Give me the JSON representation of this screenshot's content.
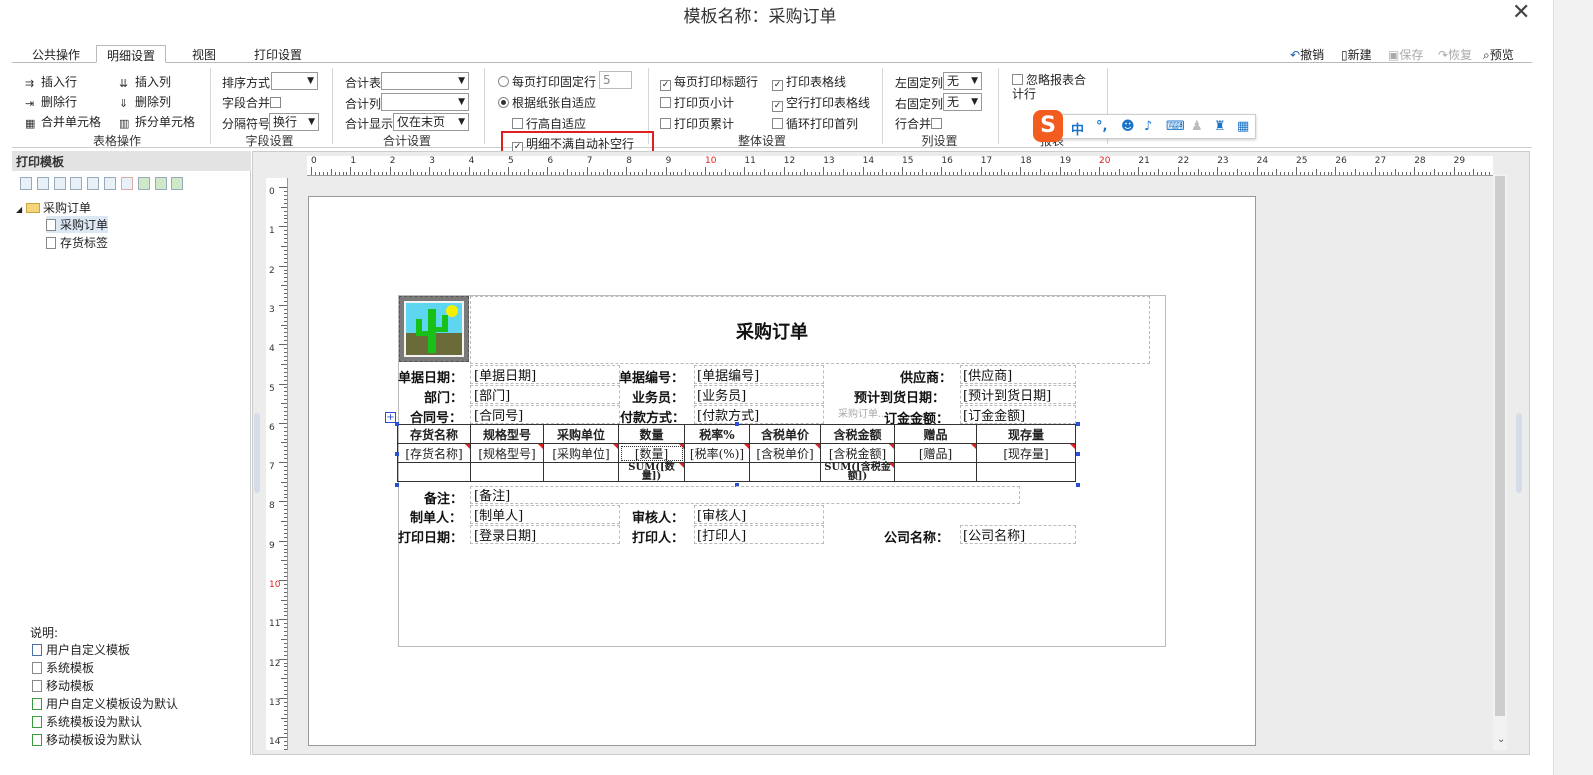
{
  "title": "模板名称：采购订单",
  "tabs": [
    "公共操作",
    "明细设置",
    "视图",
    "打印设置"
  ],
  "toolbar_buttons": {
    "undo": "撤销",
    "new": "新建",
    "save": "保存",
    "redo": "恢复",
    "preview": "预览"
  },
  "table_ops": {
    "insert_row": "插入行",
    "insert_col": "插入列",
    "delete_row": "删除行",
    "delete_col": "删除列",
    "merge": "合并单元格",
    "split": "拆分单元格",
    "group_title": "表格操作"
  },
  "field_settings": {
    "sort": "排序方式",
    "merge": "字段合并",
    "sep": "分隔符号",
    "sep_value": "换行",
    "group_title": "字段设置"
  },
  "total_settings": {
    "table": "合计表",
    "col": "合计列",
    "display": "合计显示",
    "display_value": "仅在末页",
    "group_title": "合计设置"
  },
  "page_opts": {
    "fixed": "每页打印固定行",
    "fixed_value": "5",
    "adaptive": "根据纸张自适应",
    "row_adapt": "行高自适应",
    "fill": "明细不满自动补空行"
  },
  "overall": {
    "title_row": "每页打印标题行",
    "grid": "打印表格线",
    "subtotal": "打印页小计",
    "empty_grid": "空行打印表格线",
    "cumulative": "打印页累计",
    "loop_first": "循环打印首列",
    "group_title": "整体设置"
  },
  "col_settings": {
    "left": "左固定列",
    "left_value": "无",
    "right": "右固定列",
    "right_value": "无",
    "merge": "行合并",
    "group_title": "列设置"
  },
  "report": {
    "ignore": "忽略报表合计行",
    "group_title": "报表"
  },
  "ime": {
    "mode": "中"
  },
  "left_panel": {
    "header": "打印模板",
    "folder": "采购订单",
    "items": [
      "采购订单",
      "存货标签"
    ],
    "legend_title": "说明:",
    "legend": [
      "用户自定义模板",
      "系统模板",
      "移动模板",
      "用户自定义模板设为默认",
      "系统模板设为默认",
      "移动模板设为默认"
    ]
  },
  "ruler": {
    "h": [
      "0",
      "1",
      "2",
      "3",
      "4",
      "5",
      "6",
      "7",
      "8",
      "9",
      "10",
      "11",
      "12",
      "13",
      "14",
      "15",
      "16",
      "17",
      "18",
      "19",
      "20",
      "21",
      "22",
      "23",
      "24",
      "25",
      "26",
      "27",
      "28",
      "29"
    ],
    "v": [
      "0",
      "1",
      "2",
      "3",
      "4",
      "5",
      "6",
      "7",
      "8",
      "9",
      "10",
      "11",
      "12",
      "13",
      "14"
    ]
  },
  "doc": {
    "title": "采购订单",
    "r1": {
      "l1": "单据日期：",
      "v1": "[单据日期]",
      "l2": "单据编号：",
      "v2": "[单据编号]",
      "l3": "供应商：",
      "v3": "[供应商]"
    },
    "r2": {
      "l1": "部门：",
      "v1": "[部门]",
      "l2": "业务员：",
      "v2": "[业务员]",
      "l3": "预计到货日期：",
      "v3": "[预计到货日期]"
    },
    "r3": {
      "l1": "合同号：",
      "v1": "[合同号]",
      "l2": "付款方式：",
      "v2": "[付款方式]",
      "l3": "订金金额：",
      "v3": "[订金金额]",
      "overlay": "采购订单..."
    },
    "headers": [
      "存货名称",
      "规格型号",
      "采购单位",
      "数量",
      "税率%",
      "含税单价",
      "含税金额",
      "赠品",
      "现存量"
    ],
    "cells": [
      "[存货名称]",
      "[规格型号]",
      "[采购单位]",
      "[数量]",
      "[税率(%)]",
      "[含税单价]",
      "[含税金额]",
      "[赠品]",
      "[现存量]"
    ],
    "sum_qty": "SUM([数量])",
    "sum_amt": "SUM([含税金额])",
    "remark_label": "备注：",
    "remark": "[备注]",
    "maker_label": "制单人：",
    "maker": "[制单人]",
    "auditor_label": "审核人：",
    "auditor": "[审核人]",
    "printdate_label": "打印日期：",
    "printdate": "[登录日期]",
    "printer_label": "打印人：",
    "printer": "[打印人]",
    "company_label": "公司名称：",
    "company": "[公司名称]"
  }
}
